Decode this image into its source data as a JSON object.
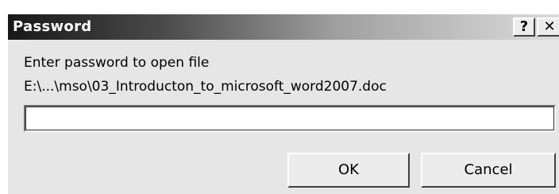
{
  "window": {
    "title": "Password",
    "help_label": "?",
    "close_label": "✕"
  },
  "dialog": {
    "prompt": "Enter password to open file",
    "file_path": "E:\\...\\mso\\03_Introducton_to_microsoft_word2007.doc",
    "password_value": ""
  },
  "buttons": {
    "ok_label": "OK",
    "cancel_label": "Cancel"
  }
}
